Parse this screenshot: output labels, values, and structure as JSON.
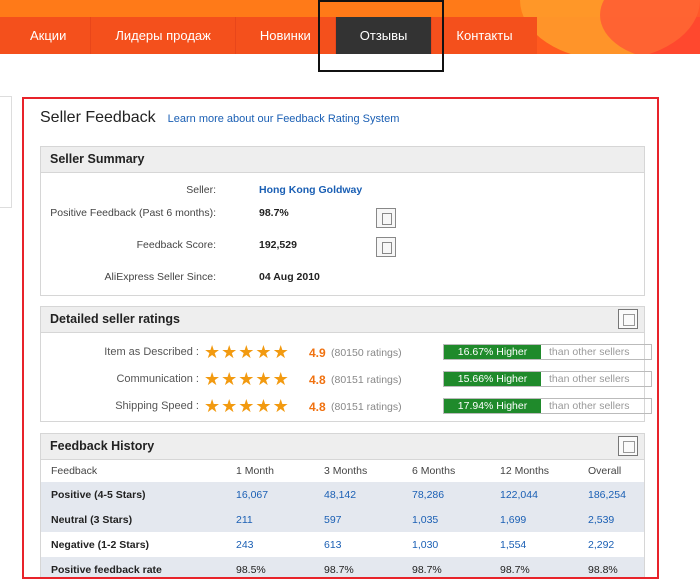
{
  "nav": {
    "items": [
      {
        "label": "Акции",
        "active": false
      },
      {
        "label": "Лидеры продаж",
        "active": false
      },
      {
        "label": "Новинки",
        "active": false
      },
      {
        "label": "Отзывы",
        "active": true
      },
      {
        "label": "Контакты",
        "active": false
      }
    ]
  },
  "feedback": {
    "title": "Seller Feedback",
    "learn_more": "Learn more about our Feedback Rating System"
  },
  "summary": {
    "heading": "Seller Summary",
    "rows": [
      {
        "label": "Seller:",
        "value": "Hong Kong Goldway",
        "link": true
      },
      {
        "label": "Positive Feedback (Past 6 months):",
        "value": "98.7%",
        "link": false
      },
      {
        "label": "Feedback Score:",
        "value": "192,529",
        "link": false
      },
      {
        "label": "AliExpress Seller Since:",
        "value": "04 Aug 2010",
        "link": false
      }
    ]
  },
  "detailed": {
    "heading": "Detailed seller ratings",
    "rows": [
      {
        "label": "Item as Described :",
        "stars": 5,
        "score": "4.9",
        "count": "(80150 ratings)",
        "higher": "16.67% Higher",
        "than": "than other sellers"
      },
      {
        "label": "Communication :",
        "stars": 5,
        "score": "4.8",
        "count": "(80151 ratings)",
        "higher": "15.66% Higher",
        "than": "than other sellers"
      },
      {
        "label": "Shipping Speed :",
        "stars": 5,
        "score": "4.8",
        "count": "(80151 ratings)",
        "higher": "17.94% Higher",
        "than": "than other sellers"
      }
    ]
  },
  "history": {
    "heading": "Feedback History",
    "columns": [
      "Feedback",
      "1 Month",
      "3 Months",
      "6 Months",
      "12 Months",
      "Overall"
    ],
    "rows": [
      {
        "label": "Positive (4-5 Stars)",
        "values": [
          "16,067",
          "48,142",
          "78,286",
          "122,044",
          "186,254"
        ]
      },
      {
        "label": "Neutral (3 Stars)",
        "values": [
          "211",
          "597",
          "1,035",
          "1,699",
          "2,539"
        ]
      },
      {
        "label": "Negative (1-2 Stars)",
        "values": [
          "243",
          "613",
          "1,030",
          "1,554",
          "2,292"
        ]
      },
      {
        "label": "Positive feedback rate",
        "values": [
          "98.5%",
          "98.7%",
          "98.7%",
          "98.7%",
          "98.8%"
        ]
      }
    ]
  },
  "colors": {
    "nav_bg": "#f4501c",
    "nav_active": "#333333",
    "link": "#1a5fb4",
    "star": "#f29a10",
    "higher_green": "#1f8a2b",
    "frame": "#e8232a"
  }
}
